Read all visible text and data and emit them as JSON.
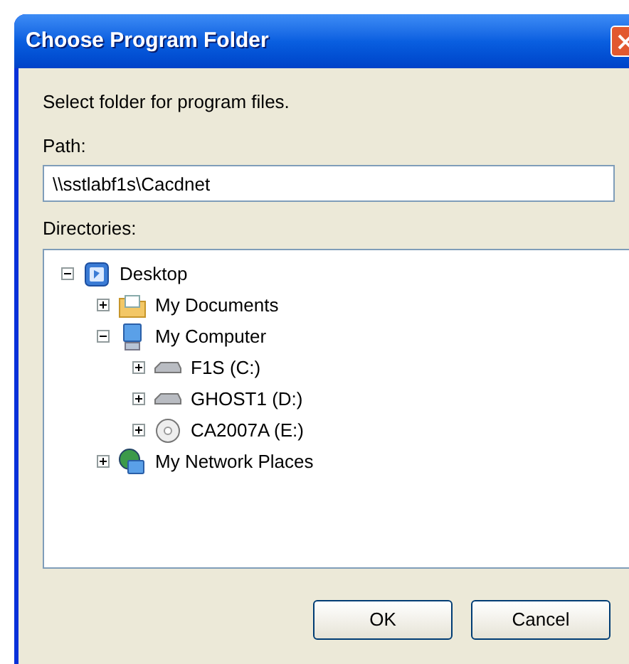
{
  "window": {
    "title": "Choose Program Folder"
  },
  "prompt": "Select folder for program files.",
  "path": {
    "label": "Path:",
    "value": "\\\\sstlabf1s\\Cacdnet"
  },
  "directories": {
    "label": "Directories:",
    "tree": [
      {
        "label": "Desktop",
        "kind": "desktop",
        "expanded": true,
        "children": [
          {
            "label": "My Documents",
            "kind": "documents",
            "expanded": false
          },
          {
            "label": "My Computer",
            "kind": "computer",
            "expanded": true,
            "children": [
              {
                "label": "F1S (C:)",
                "kind": "drive",
                "expanded": false
              },
              {
                "label": "GHOST1 (D:)",
                "kind": "drive",
                "expanded": false
              },
              {
                "label": "CA2007A (E:)",
                "kind": "cd",
                "expanded": false
              }
            ]
          },
          {
            "label": "My Network Places",
            "kind": "network",
            "expanded": false
          }
        ]
      }
    ]
  },
  "buttons": [
    "OK",
    "Cancel"
  ]
}
